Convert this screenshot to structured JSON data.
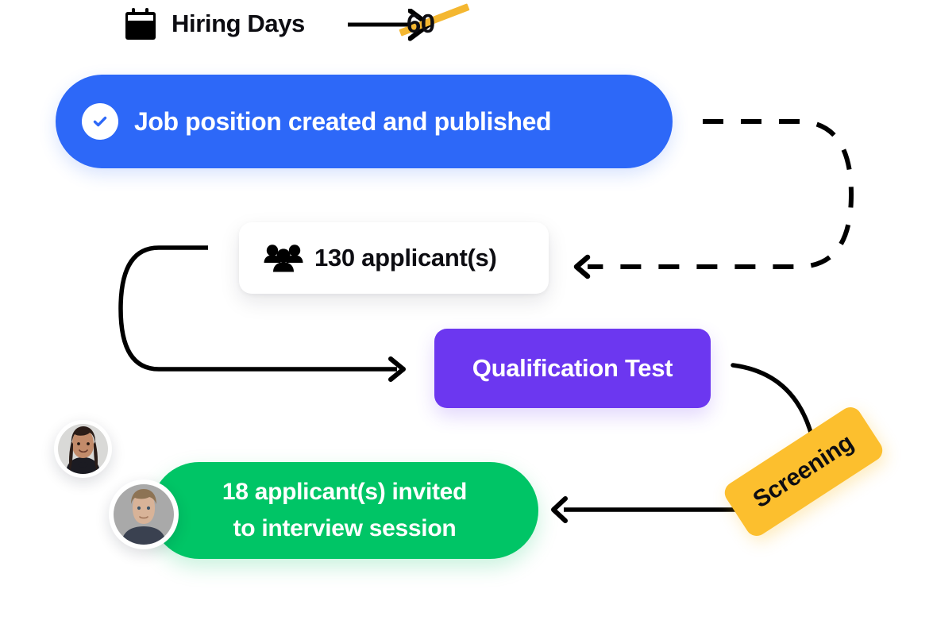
{
  "header": {
    "icon": "calendar-icon",
    "title": "Hiring Days",
    "arrow": "arrow-right-icon",
    "value": "60",
    "underline_color": "#F4B731"
  },
  "steps": {
    "published": {
      "icon": "check-circle-icon",
      "label": "Job position created and published",
      "color": "#2D68F8"
    },
    "applicants": {
      "icon": "people-group-icon",
      "label": "130 applicant(s)",
      "count": "130",
      "color": "#FFFFFF"
    },
    "qualification": {
      "label": "Qualification Test",
      "color": "#6C37F0"
    },
    "screening": {
      "label": "Screening",
      "color": "#FCBF2E"
    },
    "invited": {
      "line1": "18 applicant(s) invited",
      "line2": "to interview session",
      "count": "18",
      "color": "#00C566"
    }
  },
  "avatars": [
    {
      "name": "avatar-candidate-1"
    },
    {
      "name": "avatar-candidate-2"
    }
  ],
  "connectors": [
    {
      "name": "header-arrow",
      "style": "solid"
    },
    {
      "name": "published-to-applicants-loop",
      "style": "dashed"
    },
    {
      "name": "applicants-to-qualification-loop",
      "style": "solid"
    },
    {
      "name": "qualification-to-screening-curve",
      "style": "solid"
    },
    {
      "name": "screening-to-invited-arrow",
      "style": "solid"
    }
  ]
}
